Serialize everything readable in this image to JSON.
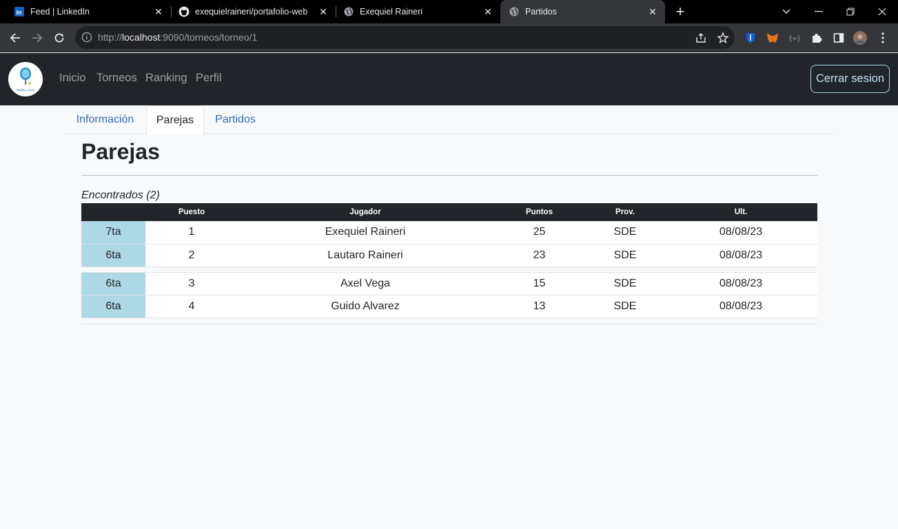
{
  "browser": {
    "tabs": [
      {
        "title": "Feed | LinkedIn",
        "icon": "linkedin-icon"
      },
      {
        "title": "exequielraineri/portafolio-web",
        "icon": "github-icon"
      },
      {
        "title": "Exequiel Raineri",
        "icon": "globe-icon"
      },
      {
        "title": "Partidos",
        "icon": "globe-icon",
        "active": true
      }
    ],
    "url_prefix": "http://",
    "url_host": "localhost",
    "url_rest": ":9090/torneos/torneo/1"
  },
  "navbar": {
    "logo_text": "PADEL LOCO",
    "links": [
      "Inicio",
      "Torneos",
      "Ranking",
      "Perfil"
    ],
    "logout_label": "Cerrar sesion"
  },
  "tabs": [
    "Información",
    "Parejas",
    "Partidos"
  ],
  "active_tab": "Parejas",
  "page_title": "Parejas",
  "found_label": "Encontrados (2)",
  "table": {
    "headers": [
      "",
      "Puesto",
      "Jugador",
      "Puntos",
      "Prov.",
      "Ult."
    ],
    "groups": [
      [
        {
          "cat": "7ta",
          "puesto": "1",
          "jugador": "Exequiel Raineri",
          "puntos": "25",
          "prov": "SDE",
          "ult": "08/08/23"
        },
        {
          "cat": "6ta",
          "puesto": "2",
          "jugador": "Lautaro Raineri",
          "puntos": "23",
          "prov": "SDE",
          "ult": "08/08/23"
        }
      ],
      [
        {
          "cat": "6ta",
          "puesto": "3",
          "jugador": "Axel Vega",
          "puntos": "15",
          "prov": "SDE",
          "ult": "08/08/23"
        },
        {
          "cat": "6ta",
          "puesto": "4",
          "jugador": "Guido Alvarez",
          "puntos": "13",
          "prov": "SDE",
          "ult": "08/08/23"
        }
      ]
    ]
  },
  "colors": {
    "category_bg": "#add8e6",
    "navbar_bg": "#212529",
    "link": "#2f6db5"
  }
}
